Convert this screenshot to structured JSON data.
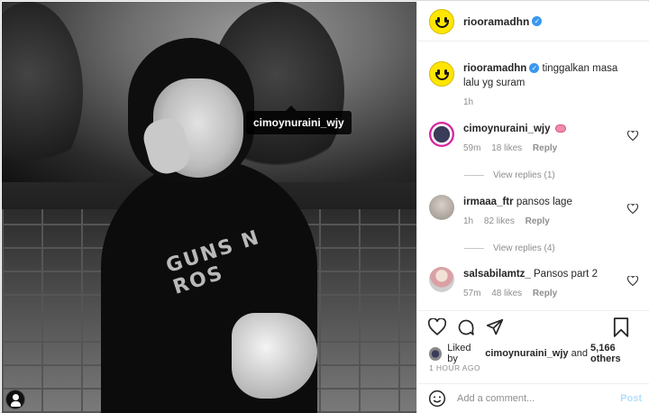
{
  "post": {
    "username": "riooramadhn",
    "verified_mark": "✓",
    "caption": "tinggalkan masa lalu yg suram",
    "caption_time": "1h",
    "photo_tag": "cimoynuraini_wjy",
    "shirt_text": "GUNS N ROS"
  },
  "comments": [
    {
      "username": "cimoynuraini_wjy",
      "text": "",
      "emoji": "brain",
      "time": "59m",
      "likes": "18 likes",
      "reply": "Reply",
      "view_replies": "View replies (1)"
    },
    {
      "username": "irmaaa_ftr",
      "text": "pansos lage",
      "time": "1h",
      "likes": "82 likes",
      "reply": "Reply",
      "view_replies": "View replies (4)"
    },
    {
      "username": "salsabilamtz_",
      "text": "Pansos part 2",
      "time": "57m",
      "likes": "48 likes",
      "reply": "Reply"
    }
  ],
  "likes": {
    "prefix": "Liked by",
    "user": "cimoynuraini_wjy",
    "joiner": "and",
    "others": "5,166 others"
  },
  "time_ago": "1 HOUR AGO",
  "add_comment": {
    "placeholder": "Add a comment...",
    "post_label": "Post"
  },
  "colors": {
    "verified": "#3897f0",
    "post_button": "#b2dffc",
    "avatar_yellow": "#ffe600"
  },
  "icons": [
    "heart-icon",
    "comment-icon",
    "share-icon",
    "bookmark-icon",
    "smile-icon",
    "user-tag-icon"
  ]
}
